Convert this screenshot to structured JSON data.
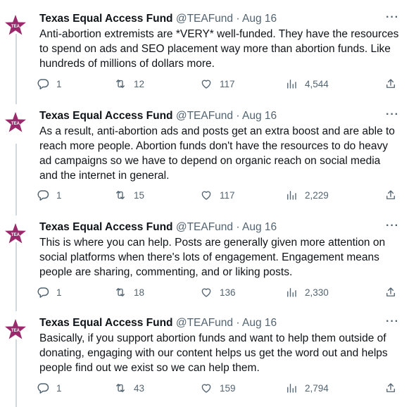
{
  "colors": {
    "accent": "#9b2a6c",
    "text": "#0f1419",
    "secondary": "#536471",
    "line": "#cfd9de"
  },
  "tweets": [
    {
      "name": "Texas Equal Access Fund",
      "handle": "@TEAFund",
      "sep": "·",
      "date": "Aug 16",
      "more": "···",
      "text": "Anti-abortion extremists are *VERY* well-funded. They have the resources to spend on ads and SEO placement way more than abortion funds. Like hundreds of millions of dollars more.",
      "replies": "1",
      "retweets": "12",
      "likes": "117",
      "views": "4,544"
    },
    {
      "name": "Texas Equal Access Fund",
      "handle": "@TEAFund",
      "sep": "·",
      "date": "Aug 16",
      "more": "···",
      "text": "As a result, anti-abortion ads and posts get an extra boost and are able to reach more people. Abortion funds don't have the resources to do heavy ad campaigns so we have to depend on organic reach on social media and the internet in general.",
      "replies": "1",
      "retweets": "15",
      "likes": "117",
      "views": "2,229"
    },
    {
      "name": "Texas Equal Access Fund",
      "handle": "@TEAFund",
      "sep": "·",
      "date": "Aug 16",
      "more": "···",
      "text": "This is where you can help. Posts are generally given more attention on social platforms when there's lots of engagement. Engagement means people are sharing, commenting, and or liking posts.",
      "replies": "1",
      "retweets": "18",
      "likes": "136",
      "views": "2,330"
    },
    {
      "name": "Texas Equal Access Fund",
      "handle": "@TEAFund",
      "sep": "·",
      "date": "Aug 16",
      "more": "···",
      "text": "Basically, if you support abortion funds and want to help them outside of donating, engaging with our content helps us get the word out and helps people find out we exist so we can help them.",
      "replies": "1",
      "retweets": "43",
      "likes": "159",
      "views": "2,794"
    }
  ],
  "icons": {
    "avatar": "star-logo-icon",
    "reply": "reply-icon",
    "retweet": "retweet-icon",
    "like": "heart-icon",
    "views": "views-icon",
    "share": "share-icon"
  }
}
